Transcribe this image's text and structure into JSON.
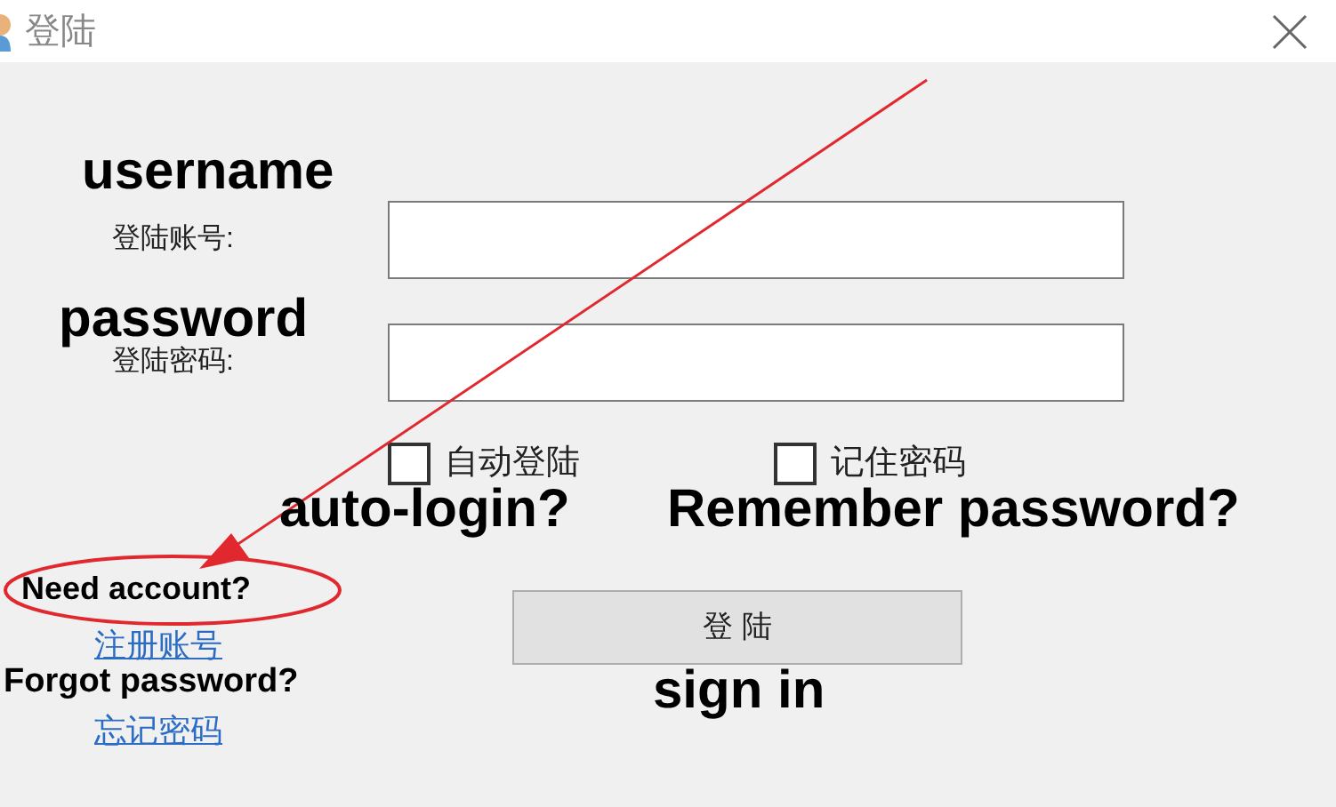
{
  "window": {
    "title": "登陆"
  },
  "form": {
    "fields": [
      {
        "label": "登陆账号:"
      },
      {
        "label": "登陆密码:"
      }
    ],
    "options": [
      {
        "label": "自动登陆",
        "checked": false
      },
      {
        "label": "记住密码",
        "checked": false
      }
    ],
    "submit": "登 陆",
    "links": [
      "注册账号",
      "忘记密码"
    ]
  },
  "annotations": [
    {
      "kind": "label",
      "text": "username"
    },
    {
      "kind": "label",
      "text": "password"
    },
    {
      "kind": "label",
      "text": "auto-login?"
    },
    {
      "kind": "label",
      "text": "Remember password?"
    },
    {
      "kind": "label",
      "text": "Need account?"
    },
    {
      "kind": "label",
      "text": "Forgot password?"
    },
    {
      "kind": "label",
      "text": "sign in"
    },
    {
      "kind": "arrow"
    },
    {
      "kind": "ellipse"
    }
  ]
}
